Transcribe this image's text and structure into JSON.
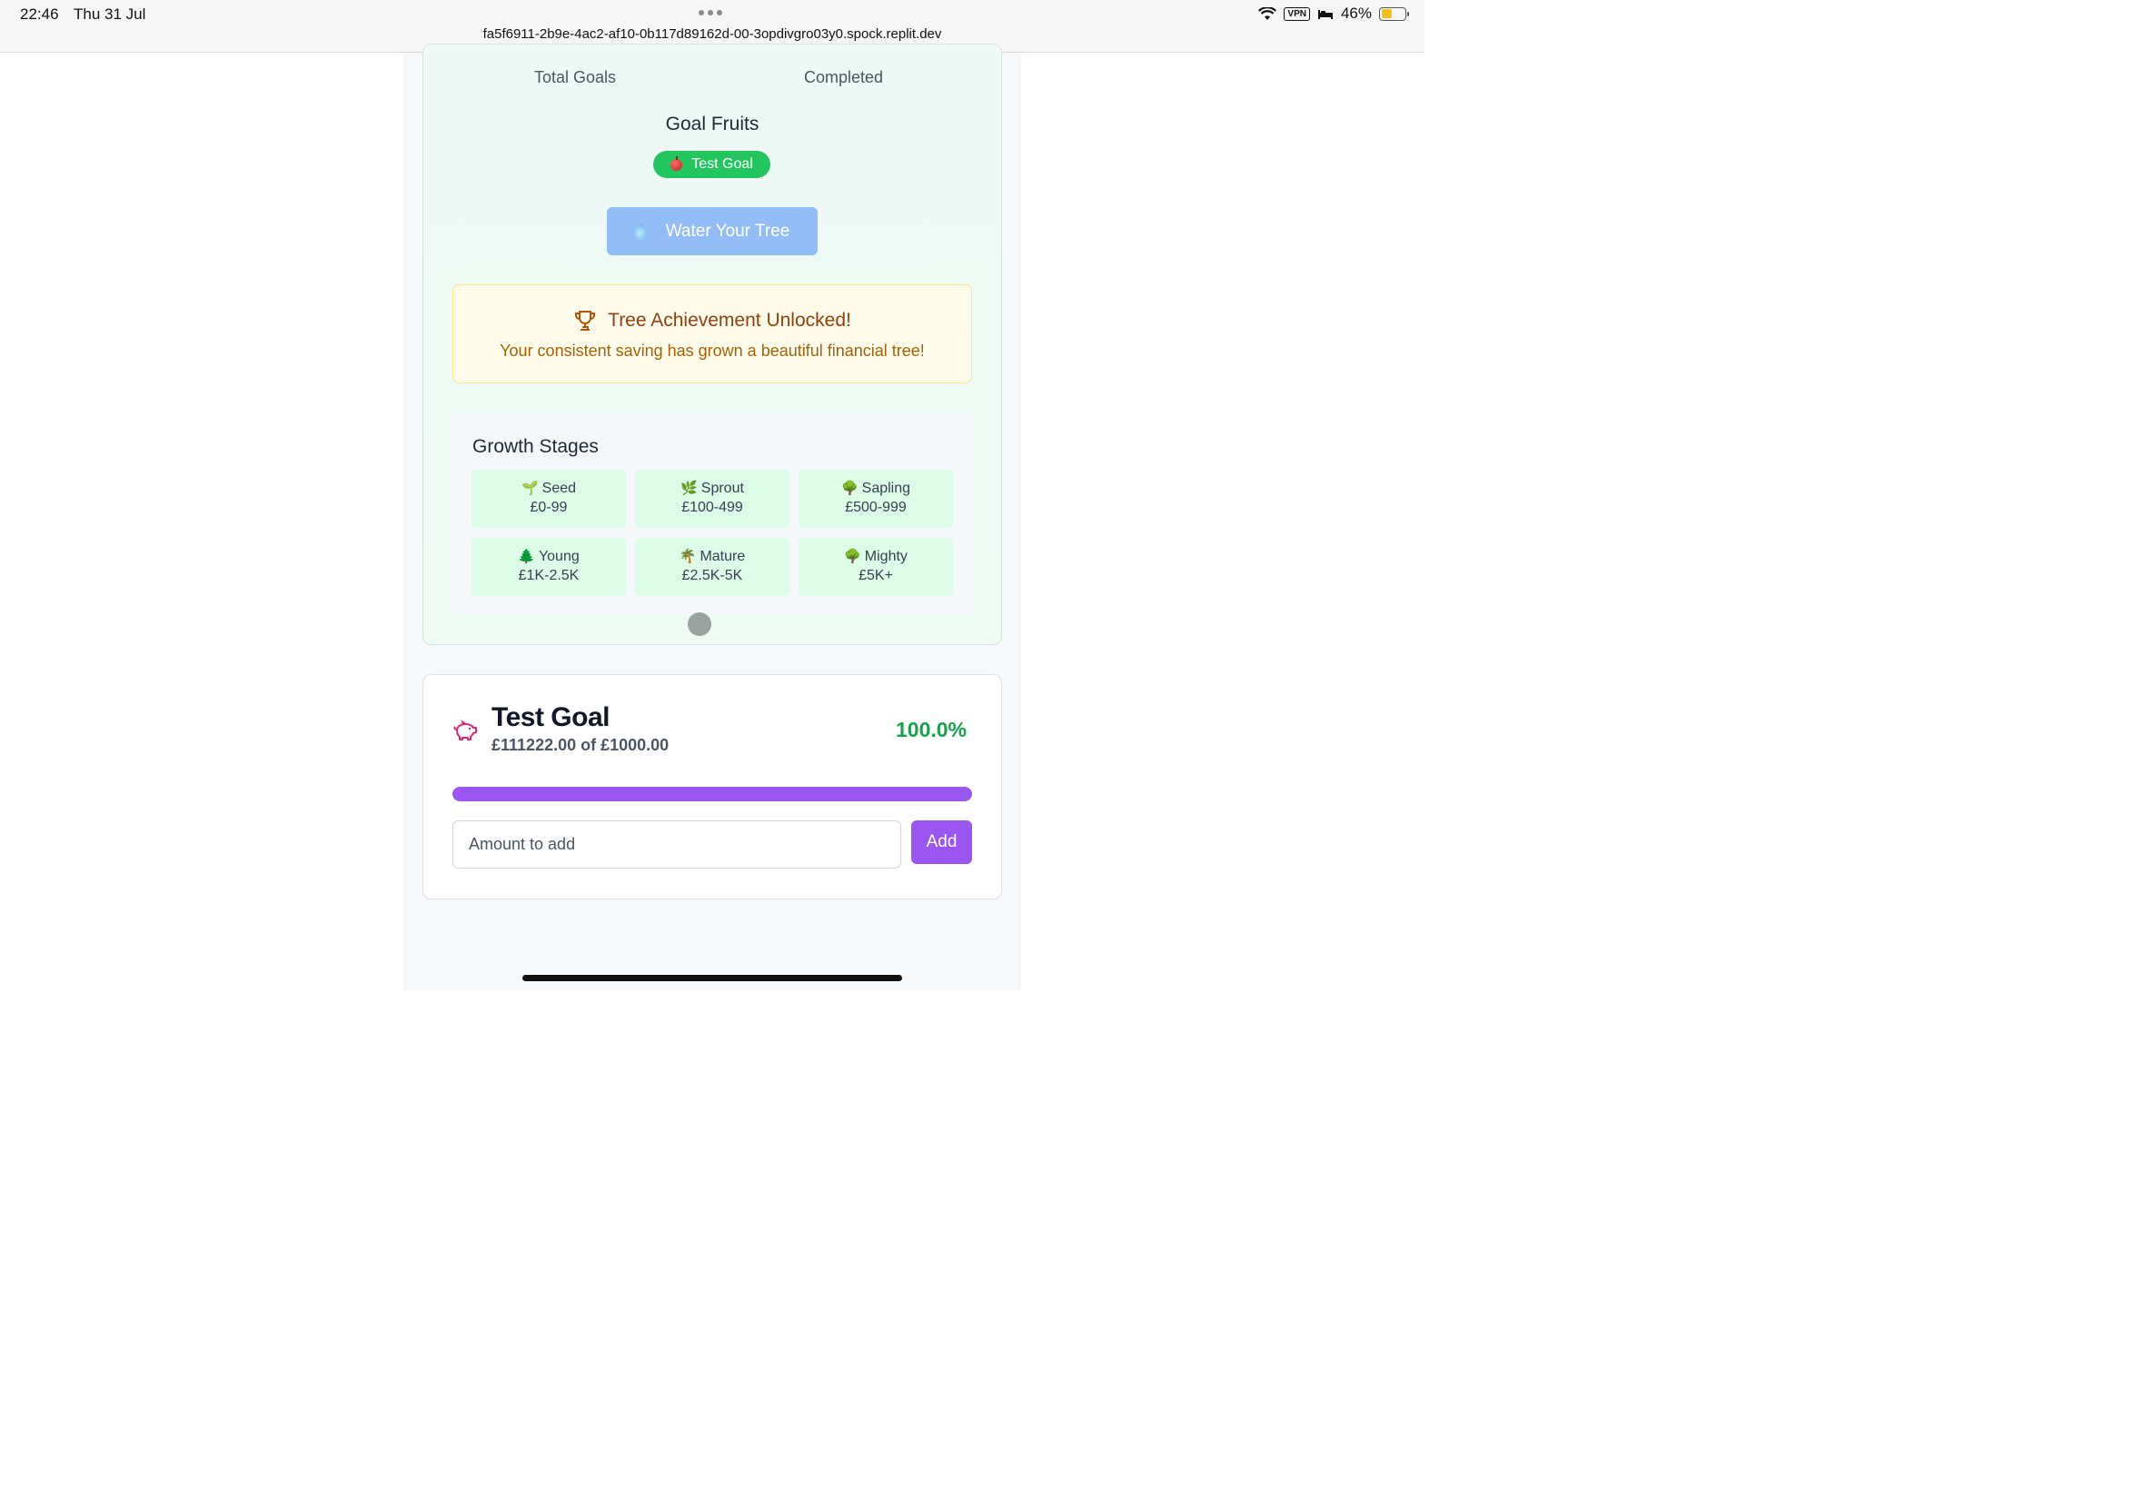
{
  "status_bar": {
    "time": "22:46",
    "date": "Thu 31 Jul",
    "url": "fa5f6911-2b9e-4ac2-af10-0b117d89162d-00-3opdivgro03y0.spock.replit.dev",
    "vpn": "VPN",
    "battery": "46%",
    "battery_level": 0.46
  },
  "stats": {
    "total_label": "Total Goals",
    "completed_label": "Completed"
  },
  "fruits": {
    "title": "Goal Fruits",
    "items": [
      {
        "label": "Test Goal",
        "icon": "apple-icon"
      }
    ]
  },
  "water_button": {
    "label": "Water Your Tree",
    "icon": "water-drop-icon"
  },
  "achievement": {
    "title": "Tree Achievement Unlocked!",
    "text": "Your consistent saving has grown a beautiful financial tree!",
    "icon": "trophy-icon"
  },
  "growth_stages": {
    "title": "Growth Stages",
    "stages": [
      {
        "emoji": "🌱",
        "name": "Seed",
        "range": "£0-99"
      },
      {
        "emoji": "🌿",
        "name": "Sprout",
        "range": "£100-499"
      },
      {
        "emoji": "🌳",
        "name": "Sapling",
        "range": "£500-999"
      },
      {
        "emoji": "🌲",
        "name": "Young",
        "range": "£1K-2.5K"
      },
      {
        "emoji": "🌴",
        "name": "Mature",
        "range": "£2.5K-5K"
      },
      {
        "emoji": "🌳",
        "name": "Mighty",
        "range": "£5K+"
      }
    ]
  },
  "goal": {
    "title": "Test Goal",
    "subtitle": "£111222.00 of £1000.00",
    "percent": "100.0%",
    "progress": 1.0,
    "icon": "piggy-bank-icon",
    "amount_placeholder": "Amount to add",
    "add_label": "Add"
  },
  "colors": {
    "accent": "#9b55f0",
    "success": "#22c55e",
    "water": "#93bdf7",
    "achievement_text": "#92400e"
  }
}
